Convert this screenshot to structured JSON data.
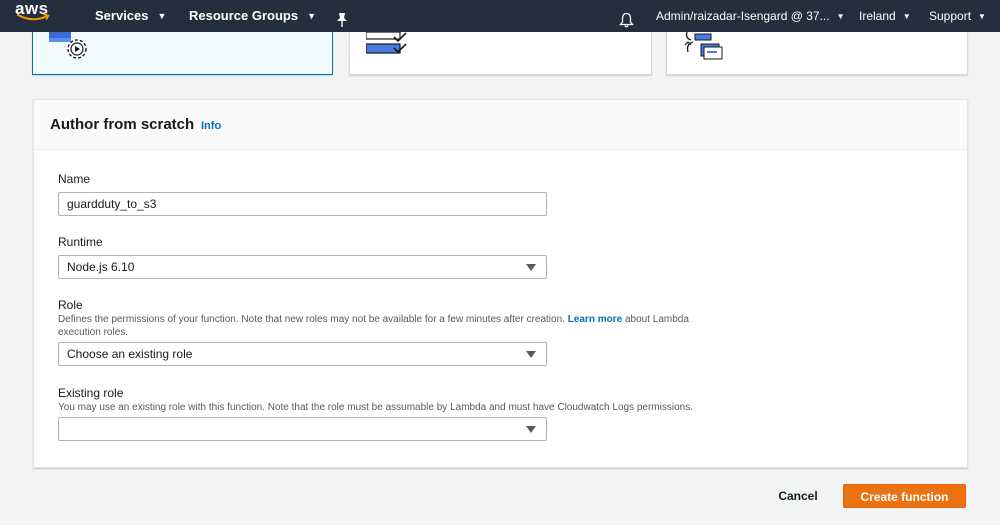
{
  "nav": {
    "logo_text": "aws",
    "services_label": "Services",
    "resource_groups_label": "Resource Groups",
    "account_label": "Admin/raizadar-Isengard @ 37...",
    "region_label": "Ireland",
    "support_label": "Support",
    "colors": {
      "background": "#232f3e",
      "logo_smile": "#ff9900"
    }
  },
  "blueprint_cards": [
    {
      "icon": "gear-play-icon",
      "selected": true
    },
    {
      "icon": "checklist-icon",
      "selected": false
    },
    {
      "icon": "repository-icon",
      "selected": false
    }
  ],
  "form": {
    "title": "Author from scratch",
    "info_link": "Info",
    "name": {
      "label": "Name",
      "value": "guardduty_to_s3"
    },
    "runtime": {
      "label": "Runtime",
      "value": "Node.js 6.10"
    },
    "role": {
      "label": "Role",
      "description_before": "Defines the permissions of your function. Note that new roles may not be available for a few minutes after creation. ",
      "description_link": "Learn more",
      "description_after": " about Lambda execution roles.",
      "value": "Choose an existing role"
    },
    "existing_role": {
      "label": "Existing role",
      "description": "You may use an existing role with this function. Note that the role must be assumable by Lambda and must have Cloudwatch Logs permissions.",
      "value": ""
    }
  },
  "footer": {
    "cancel_label": "Cancel",
    "create_label": "Create function",
    "colors": {
      "primary": "#ec7211",
      "link": "#0073bb"
    }
  }
}
